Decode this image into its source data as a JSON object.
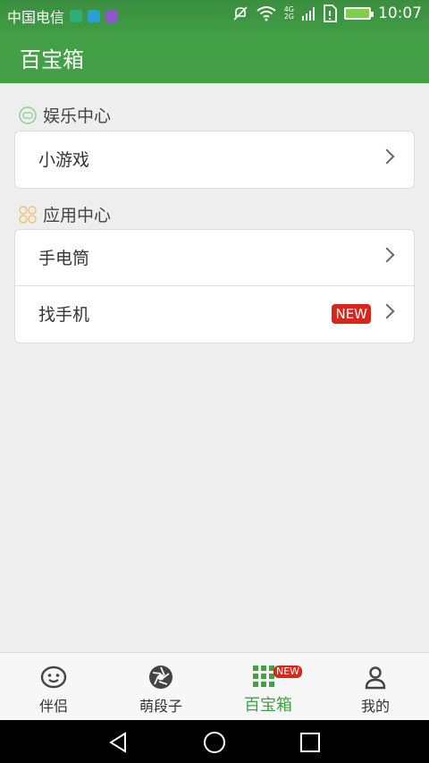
{
  "status_bar": {
    "carrier": "中国电信",
    "time": "10:07",
    "network_top": "4G",
    "network_bottom": "2G"
  },
  "app_bar": {
    "title": "百宝箱"
  },
  "sections": [
    {
      "title": "娱乐中心",
      "items": [
        {
          "label": "小游戏",
          "badge": ""
        }
      ]
    },
    {
      "title": "应用中心",
      "items": [
        {
          "label": "手电筒",
          "badge": ""
        },
        {
          "label": "找手机",
          "badge": "NEW"
        }
      ]
    }
  ],
  "tabs": [
    {
      "label": "伴侣",
      "icon": "smiley-icon",
      "active": false
    },
    {
      "label": "萌段子",
      "icon": "aperture-icon",
      "active": false
    },
    {
      "label": "百宝箱",
      "icon": "grid-icon",
      "active": true,
      "badge": "NEW"
    },
    {
      "label": "我的",
      "icon": "person-icon",
      "active": false
    }
  ],
  "colors": {
    "primary": "#43a047",
    "badge": "#d9261c",
    "background": "#eeeeee"
  }
}
